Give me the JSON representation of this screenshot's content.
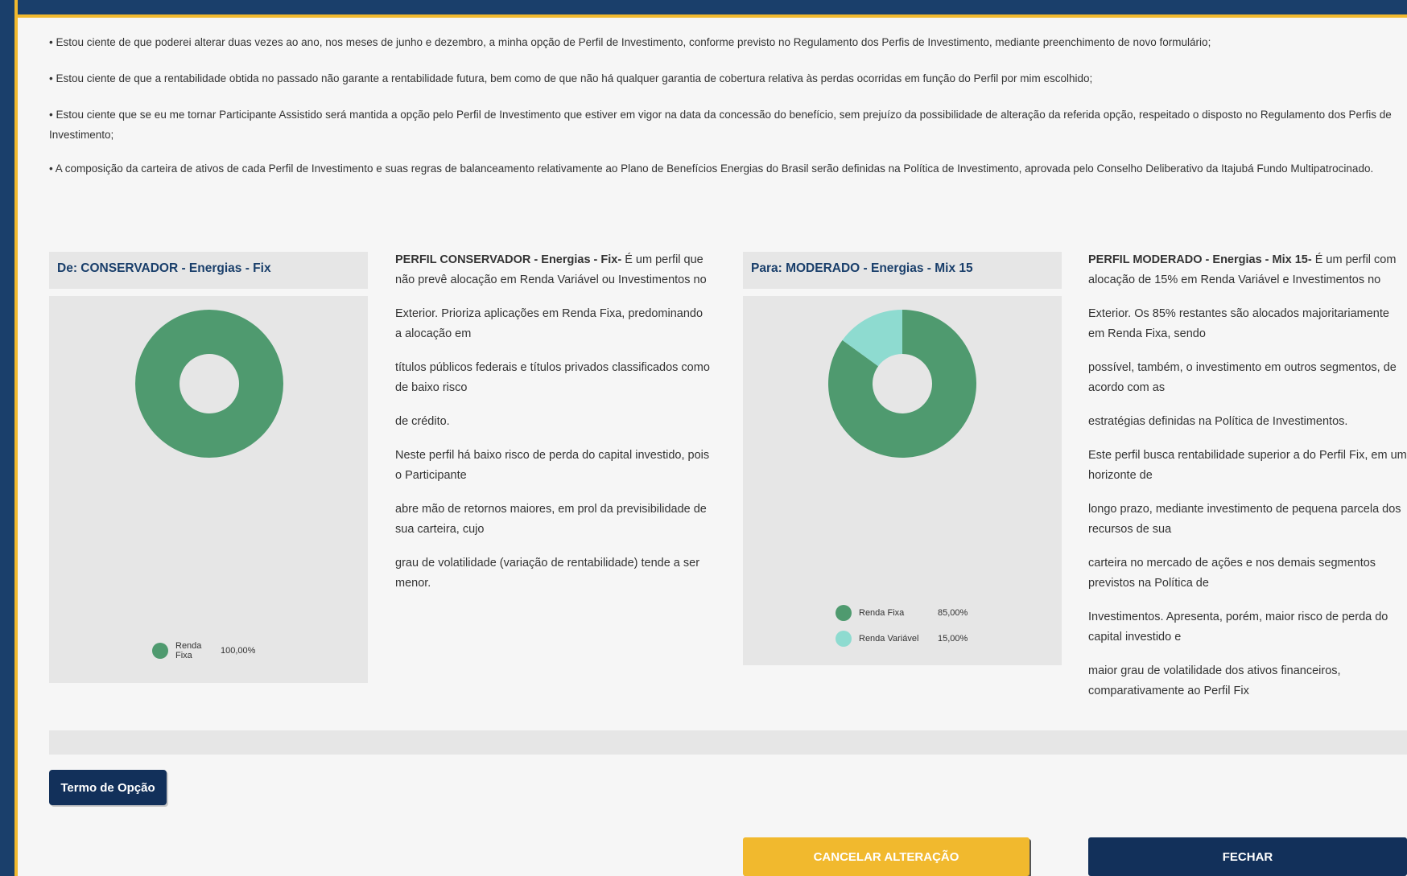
{
  "notices": [
    "• Estou ciente de que poderei alterar duas vezes ao ano, nos meses de junho e dezembro, a minha opção de Perfil de Investimento, conforme previsto no Regulamento dos Perfis de Investimento, mediante preenchimento de novo formulário;",
    "• Estou ciente de que a rentabilidade obtida no passado não garante a rentabilidade futura, bem como de que não há qualquer garantia de cobertura relativa às perdas ocorridas em função do Perfil por mim escolhido;",
    "• Estou ciente que se eu me tornar Participante Assistido será mantida a opção pelo Perfil de Investimento que estiver em vigor na data da concessão do benefício, sem prejuízo da possibilidade de alteração da referida opção, respeitado o disposto no Regulamento dos Perfis de Investimento;",
    "• A composição da carteira de ativos de cada Perfil de Investimento e suas regras de balanceamento relativamente ao Plano de Benefícios Energias do Brasil serão definidas na Política de Investimento, aprovada pelo Conselho Deliberativo da Itajubá Fundo Multipatrocinado."
  ],
  "from_profile": {
    "title": "De: CONSERVADOR - Energias - Fix",
    "desc_heading": "PERFIL CONSERVADOR - Energias - Fix-",
    "paragraphs": [
      " É um perfil que não prevê alocação em Renda Variável ou Investimentos no",
      "Exterior. Prioriza aplicações em Renda Fixa, predominando a alocação em",
      "títulos públicos federais e títulos privados classificados como de baixo risco",
      "de crédito.",
      "Neste perfil há baixo risco de perda do capital investido, pois o Participante",
      "abre mão de retornos maiores, em prol da previsibilidade de sua carteira, cujo",
      "grau de volatilidade (variação de rentabilidade) tende a ser menor."
    ]
  },
  "to_profile": {
    "title": "Para: MODERADO - Energias - Mix 15",
    "desc_heading": "PERFIL MODERADO - Energias - Mix 15-",
    "paragraphs": [
      " É um perfil com alocação de 15% em Renda Variável e Investimentos no",
      "Exterior. Os 85% restantes são alocados majoritariamente em Renda Fixa, sendo",
      "possível, também, o investimento em outros segmentos, de acordo com as",
      "estratégias definidas na Política de Investimentos.",
      "Este perfil busca rentabilidade superior a do Perfil Fix, em um horizonte de",
      "longo prazo, mediante investimento de pequena parcela dos recursos de sua",
      "carteira no mercado de ações e nos demais segmentos previstos na Política de",
      "Investimentos. Apresenta, porém, maior risco de perda do capital investido e",
      "maior grau de volatilidade dos ativos financeiros, comparativamente ao Perfil Fix"
    ]
  },
  "chart_data": [
    {
      "type": "pie",
      "categories": [
        "Renda Fixa"
      ],
      "values": [
        100
      ],
      "value_labels": [
        "100,00%"
      ],
      "colors": [
        "#4f9a6f"
      ],
      "donut": true
    },
    {
      "type": "pie",
      "categories": [
        "Renda Fixa",
        "Renda Variável"
      ],
      "values": [
        85,
        15
      ],
      "value_labels": [
        "85,00%",
        "15,00%"
      ],
      "colors": [
        "#4f9a6f",
        "#8edbd0"
      ],
      "donut": true
    }
  ],
  "buttons": {
    "termo": "Termo de Opção",
    "cancel": "CANCELAR ALTERAÇÃO",
    "close": "FECHAR"
  },
  "colors": {
    "frame": "#1a3f6b",
    "accent": "#f1b92e",
    "navy_button": "#12305a",
    "renda_fixa": "#4f9a6f",
    "renda_variavel": "#8edbd0"
  }
}
